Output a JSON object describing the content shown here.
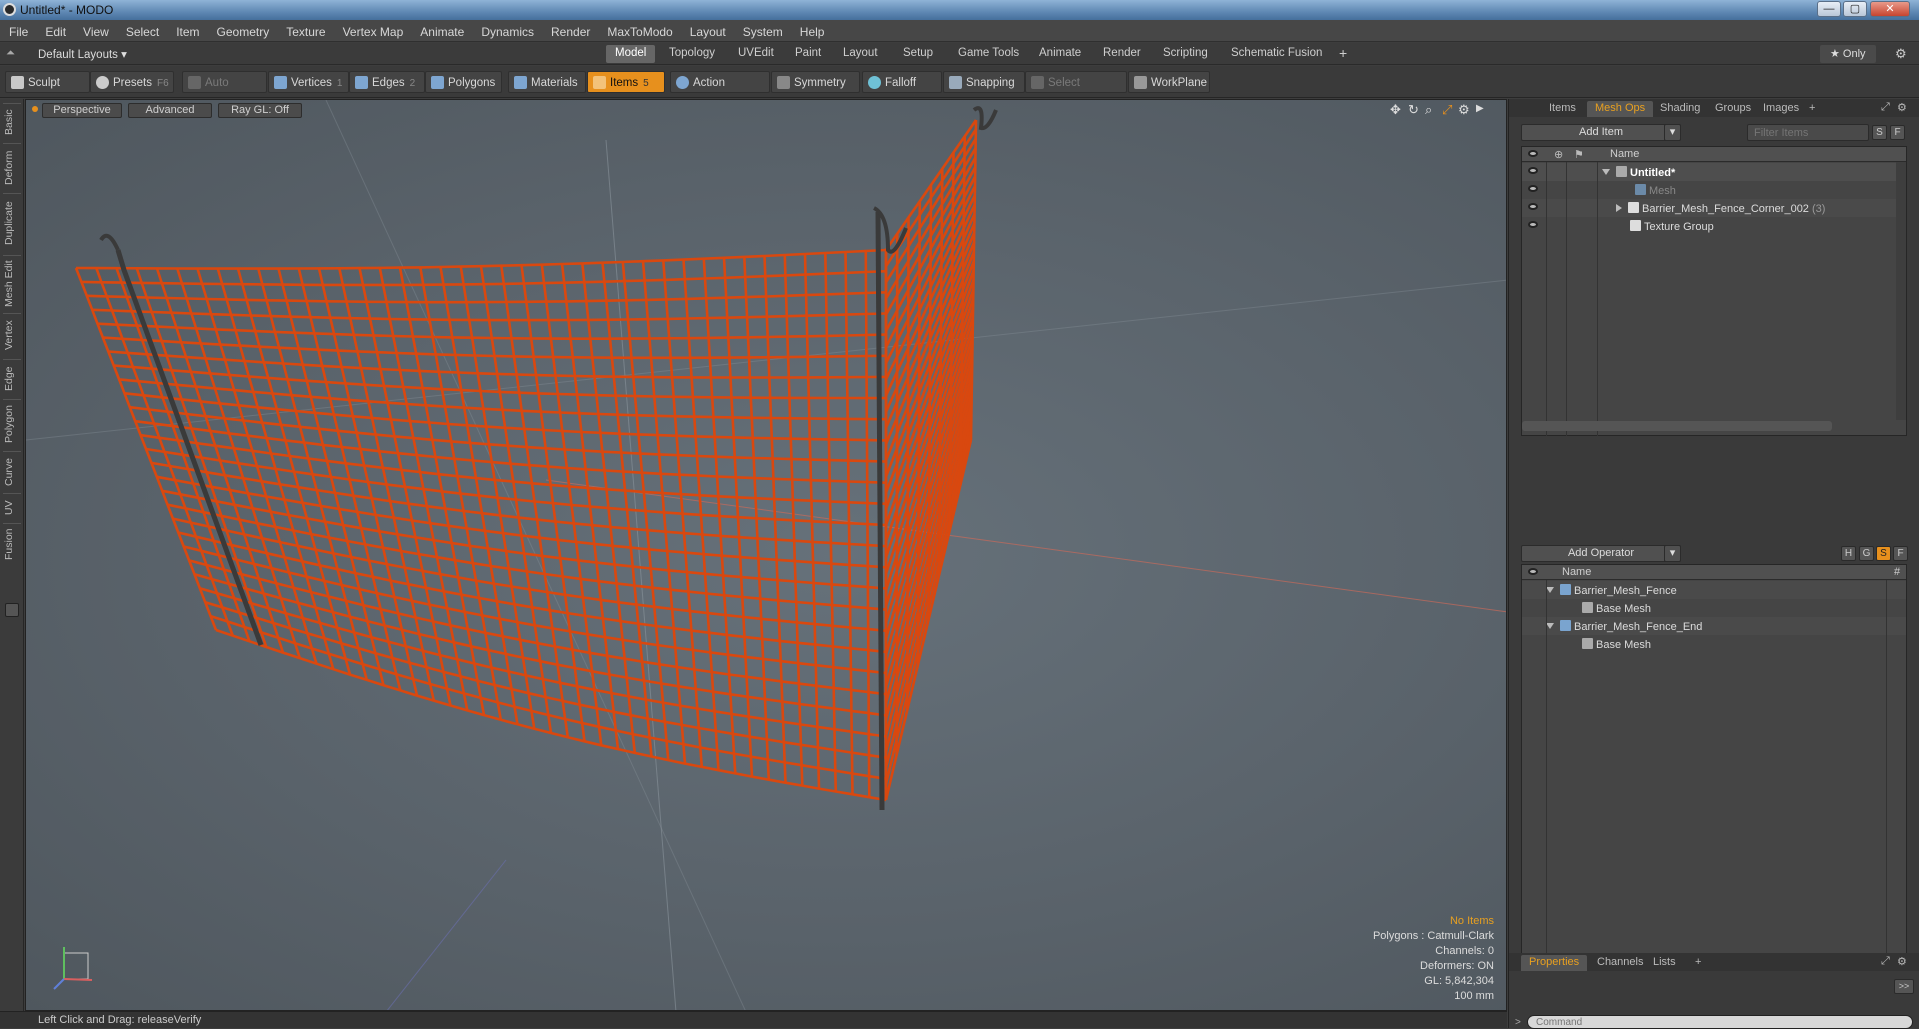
{
  "window": {
    "title": "Untitled* - MODO",
    "min": "—",
    "max": "▢",
    "close": "✕"
  },
  "menu": [
    "File",
    "Edit",
    "View",
    "Select",
    "Item",
    "Geometry",
    "Texture",
    "Vertex Map",
    "Animate",
    "Dynamics",
    "Render",
    "MaxToModo",
    "Layout",
    "System",
    "Help"
  ],
  "layoutbar": {
    "layout_dropdown": "Default Layouts ▾",
    "tabs": [
      "Model",
      "Topology",
      "UVEdit",
      "Paint",
      "Layout",
      "Setup",
      "Game Tools",
      "Animate",
      "Render",
      "Scripting",
      "Schematic Fusion"
    ],
    "active_tab": "Model",
    "add": "+",
    "only": "★  Only"
  },
  "toolbar": {
    "sculpt": "Sculpt",
    "presets": "Presets",
    "presets_key": "F6",
    "auto_select": "Auto Select",
    "vertices": "Vertices",
    "vertices_key": "1",
    "edges": "Edges",
    "edges_key": "2",
    "polygons": "Polygons",
    "materials": "Materials",
    "items": "Items",
    "items_key": "5",
    "action_center": "Action Center",
    "symmetry": "Symmetry",
    "falloff": "Falloff",
    "snapping": "Snapping",
    "select_through": "Select Through",
    "workplane": "WorkPlane"
  },
  "left_tabs": [
    "Basic",
    "Deform",
    "Duplicate",
    "Mesh Edit",
    "Vertex",
    "Edge",
    "Polygon",
    "Curve",
    "UV",
    "Fusion"
  ],
  "viewport": {
    "perspective": "Perspective",
    "advanced": "Advanced",
    "raygl": "Ray GL: Off",
    "info": {
      "no_items": "No Items",
      "polygons": "Polygons : Catmull-Clark",
      "channels": "Channels: 0",
      "deformers": "Deformers: ON",
      "gl": "GL: 5,842,304",
      "scale": "100 mm"
    }
  },
  "status": {
    "text": "Left Click and Drag:   releaseVerify"
  },
  "items_panel": {
    "tabs": [
      "Items",
      "Mesh Ops",
      "Shading",
      "Groups",
      "Images"
    ],
    "active_tab": "Mesh Ops",
    "add_item": "Add Item",
    "filter_placeholder": "Filter Items",
    "s": "S",
    "f": "F",
    "name_header": "Name",
    "rows": [
      "Untitled*",
      "Mesh",
      "Barrier_Mesh_Fence_Corner_002",
      "Texture Group"
    ],
    "count": "(3)"
  },
  "meshops_panel": {
    "add_operator": "Add Operator",
    "h": "H",
    "g": "G",
    "s": "S",
    "f": "F",
    "name_header": "Name",
    "hash": "#",
    "rows": [
      "Barrier_Mesh_Fence",
      "Base Mesh",
      "Barrier_Mesh_Fence_End",
      "Base Mesh"
    ]
  },
  "properties_panel": {
    "tabs": [
      "Properties",
      "Channels",
      "Lists"
    ],
    "active_tab": "Properties",
    "expand": ">>",
    "command_placeholder": "Command"
  },
  "colors": {
    "accent": "#e7901d",
    "fence": "#d9480f",
    "pole": "#3a3a3a"
  }
}
